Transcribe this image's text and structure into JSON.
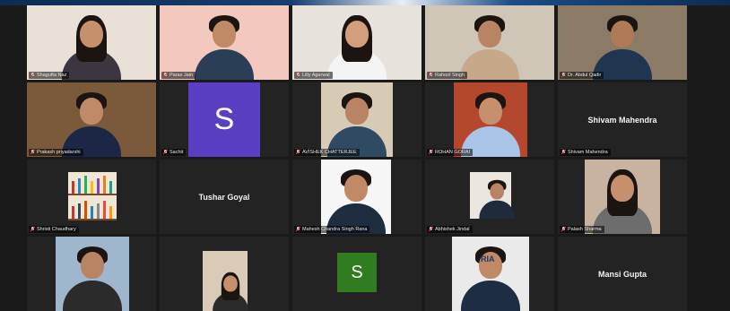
{
  "participants": [
    {
      "name": "Shagufta Naz",
      "kind": "video",
      "bg": "#e9e1d8",
      "shirt": "#3b3640",
      "skin": "#c6906c",
      "hair": "long"
    },
    {
      "name": "Paras Jain",
      "kind": "video",
      "bg": "#f3c9bf",
      "shirt": "#2a3e56",
      "skin": "#c08a66",
      "hair": "short"
    },
    {
      "name": "Lilly Agarwal",
      "kind": "video",
      "bg": "#e8e2dc",
      "shirt": "#f4f4f4",
      "skin": "#d29f7c",
      "hair": "long"
    },
    {
      "name": "Rahool Singh",
      "kind": "video",
      "bg": "#cfc6b8",
      "shirt": "#c7a989",
      "skin": "#b98463",
      "hair": "short"
    },
    {
      "name": "Dr. Abdul Qadir",
      "kind": "video",
      "bg": "#8b7a66",
      "shirt": "#1f3550",
      "skin": "#b07a58",
      "hair": "short",
      "active": true
    },
    {
      "name": "Prakash priyadarshi",
      "kind": "video",
      "bg": "#7b5a3c",
      "shirt": "#1c2746",
      "skin": "#c08a66",
      "hair": "short"
    },
    {
      "name": "Sachit",
      "kind": "avatar",
      "letter": "S",
      "avatarColor": "#5b3fc2"
    },
    {
      "name": "AVISHEK CHATTERJEE",
      "kind": "video",
      "bg": "#d8cbb6",
      "shirt": "#2f4b63",
      "skin": "#b98463",
      "hair": "short",
      "framed": true
    },
    {
      "name": "ROHAN GORAI",
      "kind": "video",
      "bg": "#b5472f",
      "shirt": "#a9c4e6",
      "skin": "#c6906c",
      "hair": "short",
      "framed": true
    },
    {
      "name": "Shivam Mahendra",
      "kind": "name"
    },
    {
      "name": "Shristi Chaudhary",
      "kind": "shelf"
    },
    {
      "name": "Tushar Goyal",
      "kind": "name",
      "noLabel": true
    },
    {
      "name": "Mahesh Chandra Singh Rana",
      "kind": "video",
      "bg": "#f7f7f7",
      "shirt": "#1e2d40",
      "skin": "#c08a66",
      "hair": "short",
      "framed": true
    },
    {
      "name": "Abhishek Jindal",
      "kind": "video",
      "bg": "#ebe6e0",
      "shirt": "#1f2a3a",
      "skin": "#b98463",
      "hair": "short",
      "framed": true,
      "small": true
    },
    {
      "name": "Palash Sharma",
      "kind": "video",
      "bg": "#c8b3a0",
      "shirt": "#6d6d6d",
      "skin": "#c6906c",
      "hair": "long",
      "framed": true
    },
    {
      "name": "",
      "kind": "video",
      "bg": "#9fb7cc",
      "shirt": "#2b2b2b",
      "skin": "#b98463",
      "hair": "short",
      "framed": true,
      "noLabel": true
    },
    {
      "name": "",
      "kind": "video",
      "bg": "#d9cbb8",
      "shirt": "#2a2a2a",
      "skin": "#c6906c",
      "hair": "long",
      "framed": true,
      "small": true,
      "noLabel": true
    },
    {
      "name": "",
      "kind": "avatar",
      "letter": "S",
      "avatarColor": "#2f7d1f",
      "small": true,
      "noLabel": true
    },
    {
      "name": "",
      "kind": "video",
      "bg": "#eaeaea",
      "shirt": "#1d2d44",
      "skin": "#c08a66",
      "hair": "short",
      "framed": true,
      "noLabel": true
    },
    {
      "name": "Mansi Gupta",
      "kind": "name",
      "noLabel": true
    }
  ],
  "banner_text": "RIA"
}
